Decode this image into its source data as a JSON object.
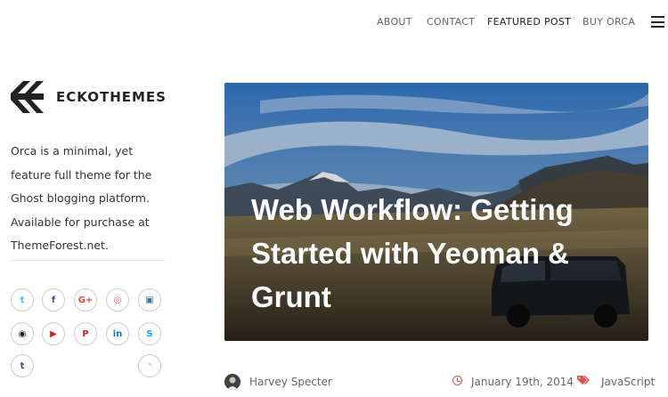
{
  "nav": {
    "items": [
      {
        "label": "ABOUT"
      },
      {
        "label": "CONTACT"
      },
      {
        "label": "FEATURED POST"
      },
      {
        "label": "BUY ORCA"
      }
    ],
    "active_color": "#222222"
  },
  "sidebar": {
    "brand_name": "ECKOTHEMES",
    "bio": "Orca is a minimal, yet feature full theme for the Ghost blogging platform. Available for purchase at ThemeForest.net.",
    "social": [
      {
        "icon": "twitter-icon",
        "glyph": "t",
        "color": "#55acee"
      },
      {
        "icon": "facebook-icon",
        "glyph": "f",
        "color": "#3b5998"
      },
      {
        "icon": "google-plus-icon",
        "glyph": "G+",
        "color": "#dd4b39"
      },
      {
        "icon": "dribbble-icon",
        "glyph": "◎",
        "color": "#ea4c89"
      },
      {
        "icon": "instagram-icon",
        "glyph": "▣",
        "color": "#3f729b"
      },
      {
        "icon": "github-icon",
        "glyph": "◉",
        "color": "#222222"
      },
      {
        "icon": "youtube-icon",
        "glyph": "▶",
        "color": "#cd201f"
      },
      {
        "icon": "pinterest-icon",
        "glyph": "P",
        "color": "#cb2027"
      },
      {
        "icon": "linkedin-icon",
        "glyph": "in",
        "color": "#007bb6"
      },
      {
        "icon": "skype-icon",
        "glyph": "S",
        "color": "#00aff0"
      },
      {
        "icon": "tumblr-icon",
        "glyph": "t",
        "color": "#32506d"
      },
      {
        "icon": "rss-icon",
        "glyph": "◝",
        "color": "#f26522"
      }
    ]
  },
  "featured_post": {
    "title": "Web Workflow: Getting Started with Yeoman & Grunt",
    "author": "Harvey Specter",
    "date": "January 19th, 2014",
    "tag": "JavaScript",
    "accent_color": "#d9534f"
  }
}
